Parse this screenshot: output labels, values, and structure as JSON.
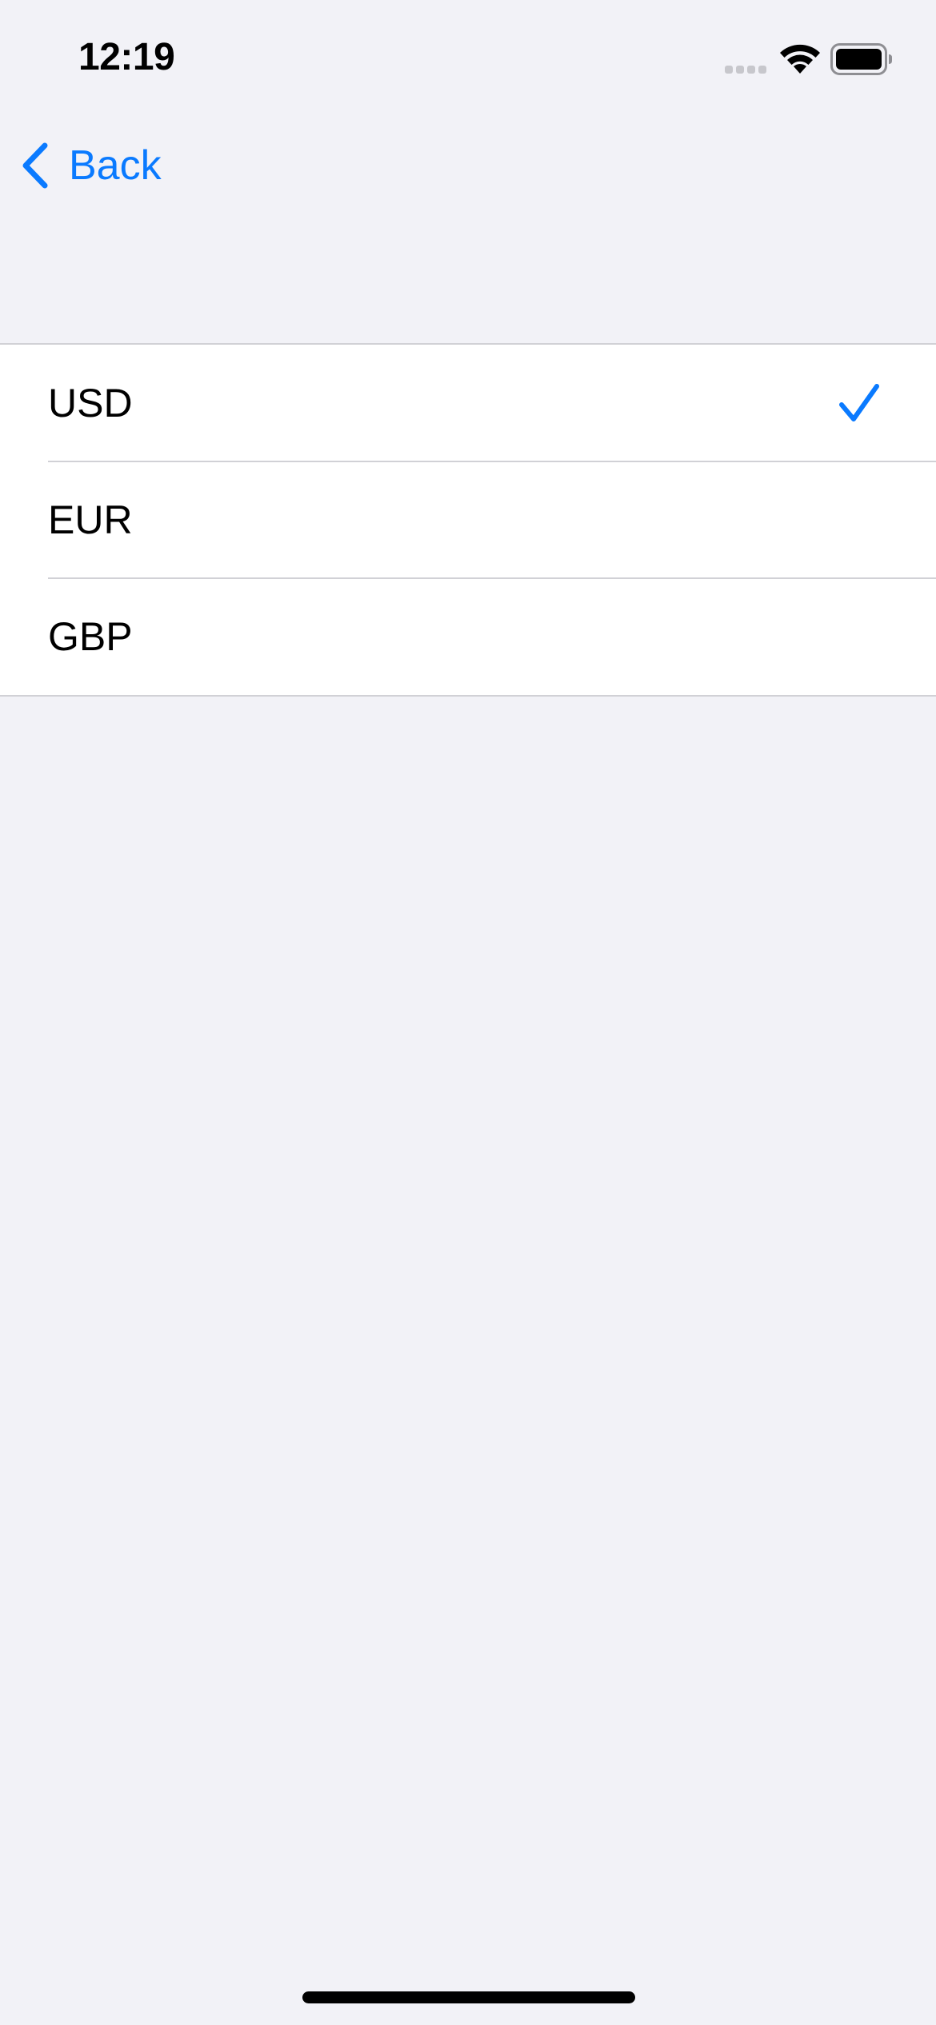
{
  "status_bar": {
    "time": "12:19"
  },
  "nav": {
    "back_label": "Back"
  },
  "currency_list": {
    "items": [
      {
        "label": "USD",
        "selected": true
      },
      {
        "label": "EUR",
        "selected": false
      },
      {
        "label": "GBP",
        "selected": false
      }
    ]
  },
  "colors": {
    "accent": "#0a7aff",
    "background": "#f2f2f7",
    "separator": "#d1d1d6"
  }
}
